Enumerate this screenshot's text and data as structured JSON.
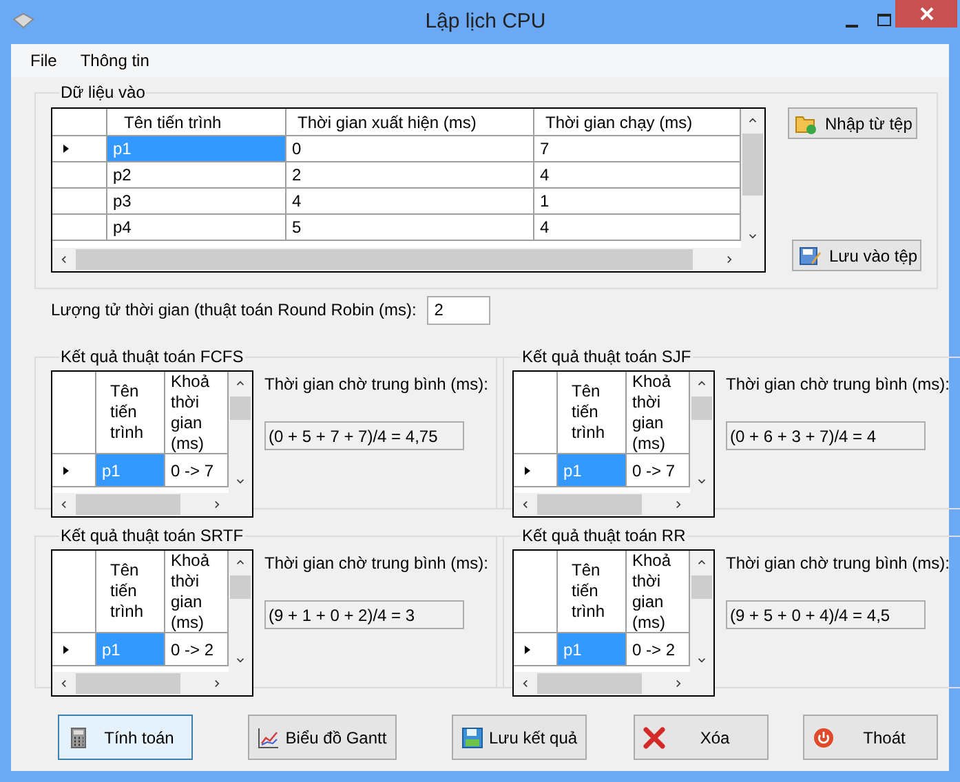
{
  "window": {
    "title": "Lập lịch CPU"
  },
  "menu": [
    "File",
    "Thông tin"
  ],
  "input_group": {
    "title": "Dữ liệu vào",
    "table": {
      "columns": [
        "Tên tiến trình",
        "Thời gian xuất hiện (ms)",
        "Thời gian chạy (ms)"
      ],
      "rows": [
        {
          "cells": [
            "p1",
            "0",
            "7"
          ],
          "selected": true
        },
        {
          "cells": [
            "p2",
            "2",
            "4"
          ],
          "selected": false
        },
        {
          "cells": [
            "p3",
            "4",
            "1"
          ],
          "selected": false
        },
        {
          "cells": [
            "p4",
            "5",
            "4"
          ],
          "selected": false
        }
      ]
    },
    "buttons": [
      {
        "label": "Nhập từ tệp",
        "kind": "import"
      },
      {
        "label": "Lưu vào tệp",
        "kind": "export"
      }
    ]
  },
  "quantum": {
    "label": "Lượng tử thời gian (thuật toán Round Robin (ms):",
    "value": "2"
  },
  "results": [
    {
      "title": "Kết quả thuật toán FCFS",
      "table": {
        "columns": [
          "Tên tiến trình",
          "Khoả thời gian (ms)"
        ],
        "rows": [
          {
            "cells": [
              "p1",
              "0 -> 7"
            ],
            "selected": true
          }
        ]
      },
      "avg_label": "Thời gian chờ trung bình (ms):",
      "avg_value": "(0 + 5 + 7 + 7)/4 = 4,75"
    },
    {
      "title": "Kết quả thuật toán SJF",
      "table": {
        "columns": [
          "Tên tiến trình",
          "Khoả thời gian (ms)"
        ],
        "rows": [
          {
            "cells": [
              "p1",
              "0 -> 7"
            ],
            "selected": true
          }
        ]
      },
      "avg_label": "Thời gian chờ trung bình (ms):",
      "avg_value": "(0 + 6 + 3 + 7)/4 = 4"
    },
    {
      "title": "Kết quả thuật toán SRTF",
      "table": {
        "columns": [
          "Tên tiến trình",
          "Khoả thời gian (ms)"
        ],
        "rows": [
          {
            "cells": [
              "p1",
              "0 -> 2"
            ],
            "selected": true
          }
        ]
      },
      "avg_label": "Thời gian chờ trung bình (ms):",
      "avg_value": "(9 + 1 + 0 + 2)/4 = 3"
    },
    {
      "title": "Kết quả thuật toán RR",
      "table": {
        "columns": [
          "Tên tiến trình",
          "Khoả thời gian (ms)"
        ],
        "rows": [
          {
            "cells": [
              "p1",
              "0 -> 2"
            ],
            "selected": true
          }
        ]
      },
      "avg_label": "Thời gian chờ trung bình (ms):",
      "avg_value": "(9 + 5 + 0 + 4)/4 = 4,5"
    }
  ],
  "buttons": [
    {
      "label": "Tính toán",
      "kind": "compute",
      "focused": true
    },
    {
      "label": "Biểu đồ Gantt",
      "kind": "gantt",
      "focused": false
    },
    {
      "label": "Lưu kết quả",
      "kind": "save",
      "focused": false
    },
    {
      "label": "Xóa",
      "kind": "clear",
      "focused": false
    },
    {
      "label": "Thoát",
      "kind": "exit",
      "focused": false
    }
  ]
}
